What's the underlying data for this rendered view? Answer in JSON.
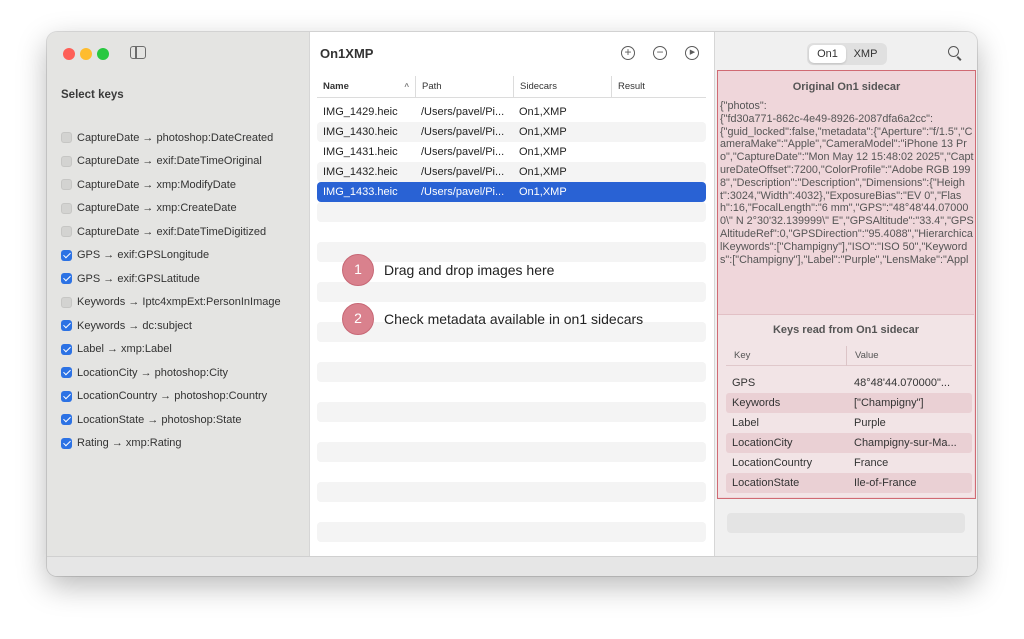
{
  "sidebar": {
    "title": "Select keys",
    "keys": [
      {
        "label": "CaptureDate → photoshop:DateCreated",
        "checked": false
      },
      {
        "label": "CaptureDate → exif:DateTimeOriginal",
        "checked": false
      },
      {
        "label": "CaptureDate → xmp:ModifyDate",
        "checked": false
      },
      {
        "label": "CaptureDate → xmp:CreateDate",
        "checked": false
      },
      {
        "label": "CaptureDate → exif:DateTimeDigitized",
        "checked": false
      },
      {
        "label": "GPS → exif:GPSLongitude",
        "checked": true
      },
      {
        "label": "GPS → exif:GPSLatitude",
        "checked": true
      },
      {
        "label": "Keywords → Iptc4xmpExt:PersonInImage",
        "checked": false
      },
      {
        "label": "Keywords → dc:subject",
        "checked": true
      },
      {
        "label": "Label → xmp:Label",
        "checked": true
      },
      {
        "label": "LocationCity → photoshop:City",
        "checked": true
      },
      {
        "label": "LocationCountry → photoshop:Country",
        "checked": true
      },
      {
        "label": "LocationState → photoshop:State",
        "checked": true
      },
      {
        "label": "Rating → xmp:Rating",
        "checked": true
      }
    ]
  },
  "main": {
    "title": "On1XMP",
    "columns": {
      "name": "Name",
      "path": "Path",
      "sidecars": "Sidecars",
      "result": "Result"
    },
    "files": [
      {
        "name": "IMG_1429.heic",
        "path": "/Users/pavel/Pi...",
        "sidecars": "On1,XMP",
        "selected": false
      },
      {
        "name": "IMG_1430.heic",
        "path": "/Users/pavel/Pi...",
        "sidecars": "On1,XMP",
        "selected": false
      },
      {
        "name": "IMG_1431.heic",
        "path": "/Users/pavel/Pi...",
        "sidecars": "On1,XMP",
        "selected": false
      },
      {
        "name": "IMG_1432.heic",
        "path": "/Users/pavel/Pi...",
        "sidecars": "On1,XMP",
        "selected": false
      },
      {
        "name": "IMG_1433.heic",
        "path": "/Users/pavel/Pi...",
        "sidecars": "On1,XMP",
        "selected": true
      }
    ],
    "steps": [
      {
        "number": "1",
        "text": "Drag and drop images here"
      },
      {
        "number": "2",
        "text": "Check metadata available in on1 sidecars"
      }
    ]
  },
  "right": {
    "segments": {
      "on1": "On1",
      "xmp": "XMP"
    },
    "original_title": "Original On1 sidecar",
    "original_json": "{\"photos\":\n{\"fd30a771-862c-4e49-8926-2087dfa6a2cc\":\n{\"guid_locked\":false,\"metadata\":{\"Aperture\":\"f/1.5\",\"CameraMake\":\"Apple\",\"CameraModel\":\"iPhone 13 Pro\",\"CaptureDate\":\"Mon May 12 15:48:02 2025\",\"CaptureDateOffset\":7200,\"ColorProfile\":\"Adobe RGB 1998\",\"Description\":\"Description\",\"Dimensions\":{\"Height\":3024,\"Width\":4032},\"ExposureBias\":\"EV 0\",\"Flash\":16,\"FocalLength\":\"6 mm\",\"GPS\":\"48°48'44.070000\\\" N 2°30'32.139999\\\" E\",\"GPSAltitude\":\"33.4\",\"GPSAltitudeRef\":0,\"GPSDirection\":\"95.4088\",\"HierarchicalKeywords\":[\"Champigny\"],\"ISO\":\"ISO 50\",\"Keywords\":[\"Champigny\"],\"Label\":\"Purple\",\"LensMake\":\"Appl",
    "keys_title": "Keys read from On1 sidecar",
    "kv_columns": {
      "key": "Key",
      "value": "Value"
    },
    "kv_rows": [
      {
        "key": "GPS",
        "value": "48°48'44.070000\"..."
      },
      {
        "key": "Keywords",
        "value": "[\"Champigny\"]"
      },
      {
        "key": "Label",
        "value": "Purple"
      },
      {
        "key": "LocationCity",
        "value": "Champigny-sur-Ma..."
      },
      {
        "key": "LocationCountry",
        "value": "France"
      },
      {
        "key": "LocationState",
        "value": "Ile-of-France"
      }
    ]
  },
  "colors": {
    "accent": "#2962d4",
    "highlight": "#d06a73",
    "step_badge": "#d9818d"
  }
}
